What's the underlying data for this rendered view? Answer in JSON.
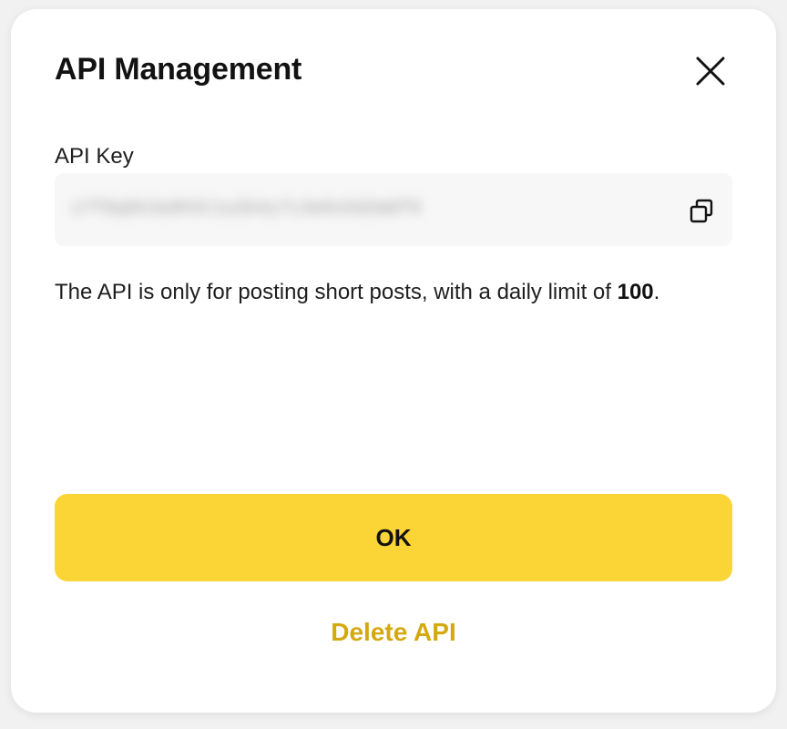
{
  "dialog": {
    "title": "API Management",
    "close_icon": "close-icon"
  },
  "api_key": {
    "label": "API Key",
    "value": "z7f8q6k3a9h5t1u2b4y7c3e8s5d2m6f9",
    "copy_icon": "copy-icon"
  },
  "description": {
    "text_before": "The API is only for posting short posts, with a daily limit of ",
    "limit": "100",
    "text_after": "."
  },
  "actions": {
    "ok_label": "OK",
    "delete_label": "Delete API"
  },
  "colors": {
    "accent": "#fad535",
    "danger_link": "#d4a90f",
    "field_bg": "#f7f7f7"
  }
}
